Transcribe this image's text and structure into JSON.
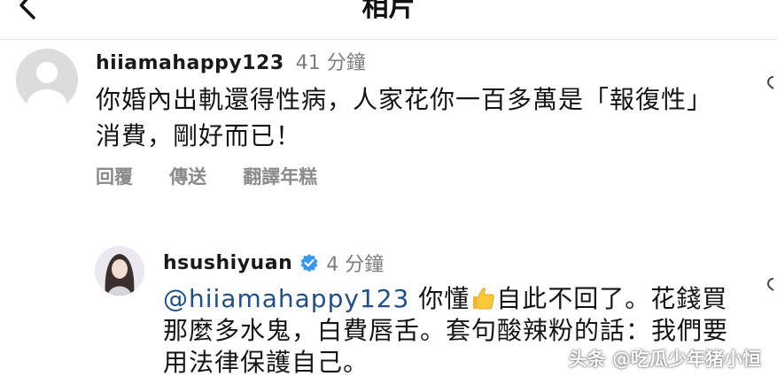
{
  "header": {
    "title": "相片"
  },
  "comments": [
    {
      "username": "hiiamahappy123",
      "time": "41 分鐘",
      "text": "你婚內出軌還得性病，人家花你一百多萬是「報復性」消費，剛好而已！",
      "actions": {
        "reply": "回覆",
        "send": "傳送",
        "translate": "翻譯年糕"
      }
    },
    {
      "username": "hsushiyuan",
      "time": "4 分鐘",
      "verified": true,
      "mention": "@hiiamahappy123",
      "text_part1": " 你懂",
      "text_part2": "自此不回了。花錢買那麼多水鬼，白費唇舌。套句酸辣粉的話：我們要用法律保護自己。"
    }
  ],
  "watermark": "头条 @吃瓜少年猪小恒",
  "icons": {
    "back": "chevron-left-icon",
    "verified": "verified-badge-icon",
    "thumbs": "thumbs-up-icon",
    "like": "heart-icon"
  },
  "colors": {
    "mention": "#1f4f8a",
    "verified": "#3897f0",
    "muted": "#8a8a8a"
  }
}
